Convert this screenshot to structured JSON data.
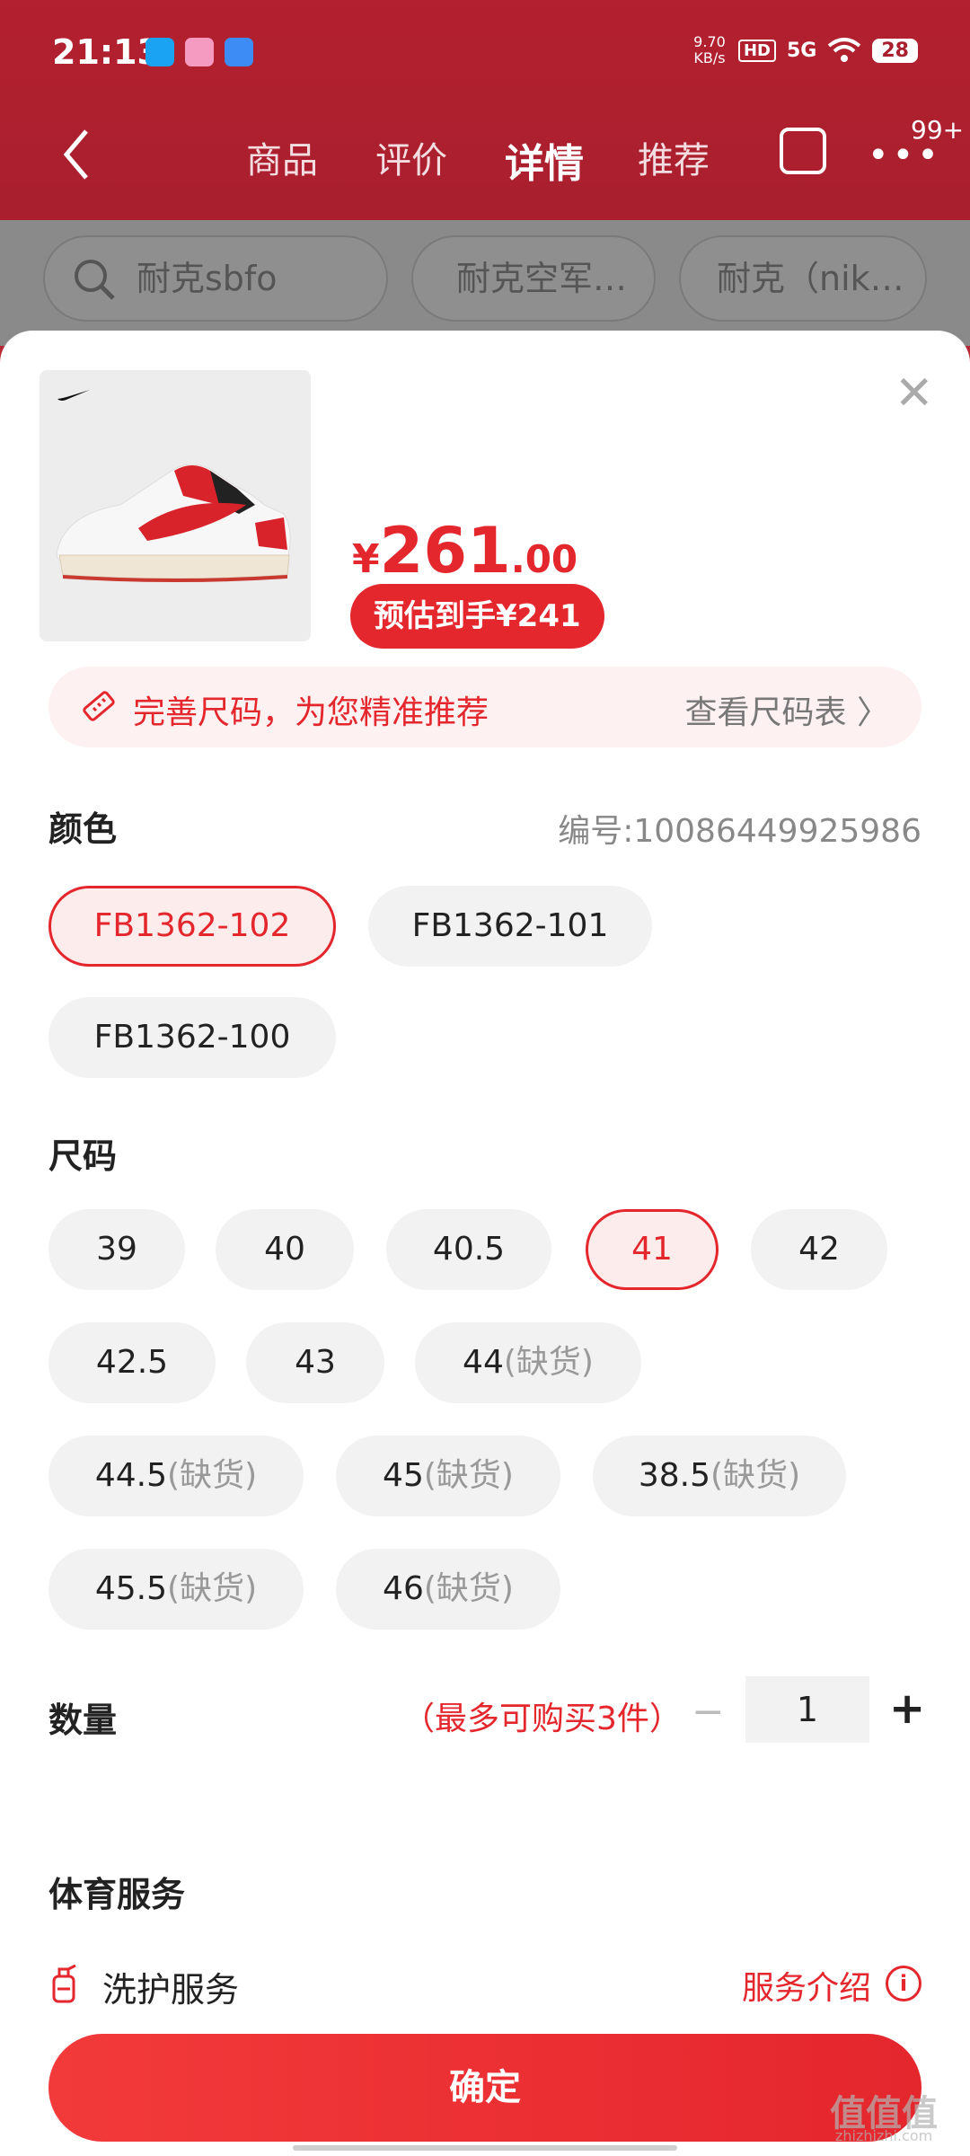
{
  "status_bar": {
    "time": "21:13",
    "net_speed": "9.70 KB/s",
    "hd": "HD",
    "signal": "5G",
    "battery": "28"
  },
  "nav": {
    "back_icon": "chevron-left-icon",
    "tabs": [
      "商品",
      "评价",
      "详情",
      "推荐"
    ],
    "active_tab": "详情",
    "share_icon": "share-icon",
    "more_icon": "more-dots-icon",
    "message_badge": "99+"
  },
  "search_row": {
    "query": "耐克sbfo",
    "suggestions": [
      "耐克空军…",
      "耐克（nik…"
    ]
  },
  "sheet": {
    "product_image": "nike-shoe-image",
    "price_currency": "¥",
    "price_int": "261",
    "price_dec": ".00",
    "estimate": "预估到手¥241",
    "size_tip": "完善尺码，为您精准推荐",
    "size_chart_link": "查看尺码表 〉",
    "color_label": "颜色",
    "item_code": "编号:10086449925986",
    "colors": [
      "FB1362-102",
      "FB1362-101",
      "FB1362-100"
    ],
    "selected_color": "FB1362-102",
    "size_label": "尺码",
    "sizes": [
      {
        "value": "39",
        "stock": ""
      },
      {
        "value": "40",
        "stock": ""
      },
      {
        "value": "40.5",
        "stock": ""
      },
      {
        "value": "41",
        "stock": ""
      },
      {
        "value": "42",
        "stock": ""
      },
      {
        "value": "42.5",
        "stock": ""
      },
      {
        "value": "43",
        "stock": ""
      },
      {
        "value": "44",
        "stock": "(缺货)"
      },
      {
        "value": "44.5",
        "stock": "(缺货)"
      },
      {
        "value": "45",
        "stock": "(缺货)"
      },
      {
        "value": "38.5",
        "stock": "(缺货)"
      },
      {
        "value": "45.5",
        "stock": "(缺货)"
      },
      {
        "value": "46",
        "stock": "(缺货)"
      }
    ],
    "selected_size": "41",
    "quantity_label": "数量",
    "quantity_limit": "（最多可购买3件）",
    "quantity": "1",
    "minus": "−",
    "plus": "+",
    "sports_service_label": "体育服务",
    "service_name": "洗护服务",
    "service_intro": "服务介绍",
    "info_glyph": "i",
    "confirm": "确定",
    "close": "✕"
  },
  "watermark": {
    "text": "值值值",
    "domain": "zhizhizhi.com"
  },
  "colors": {
    "accent": "#e4262d",
    "header": "#b3202f"
  }
}
